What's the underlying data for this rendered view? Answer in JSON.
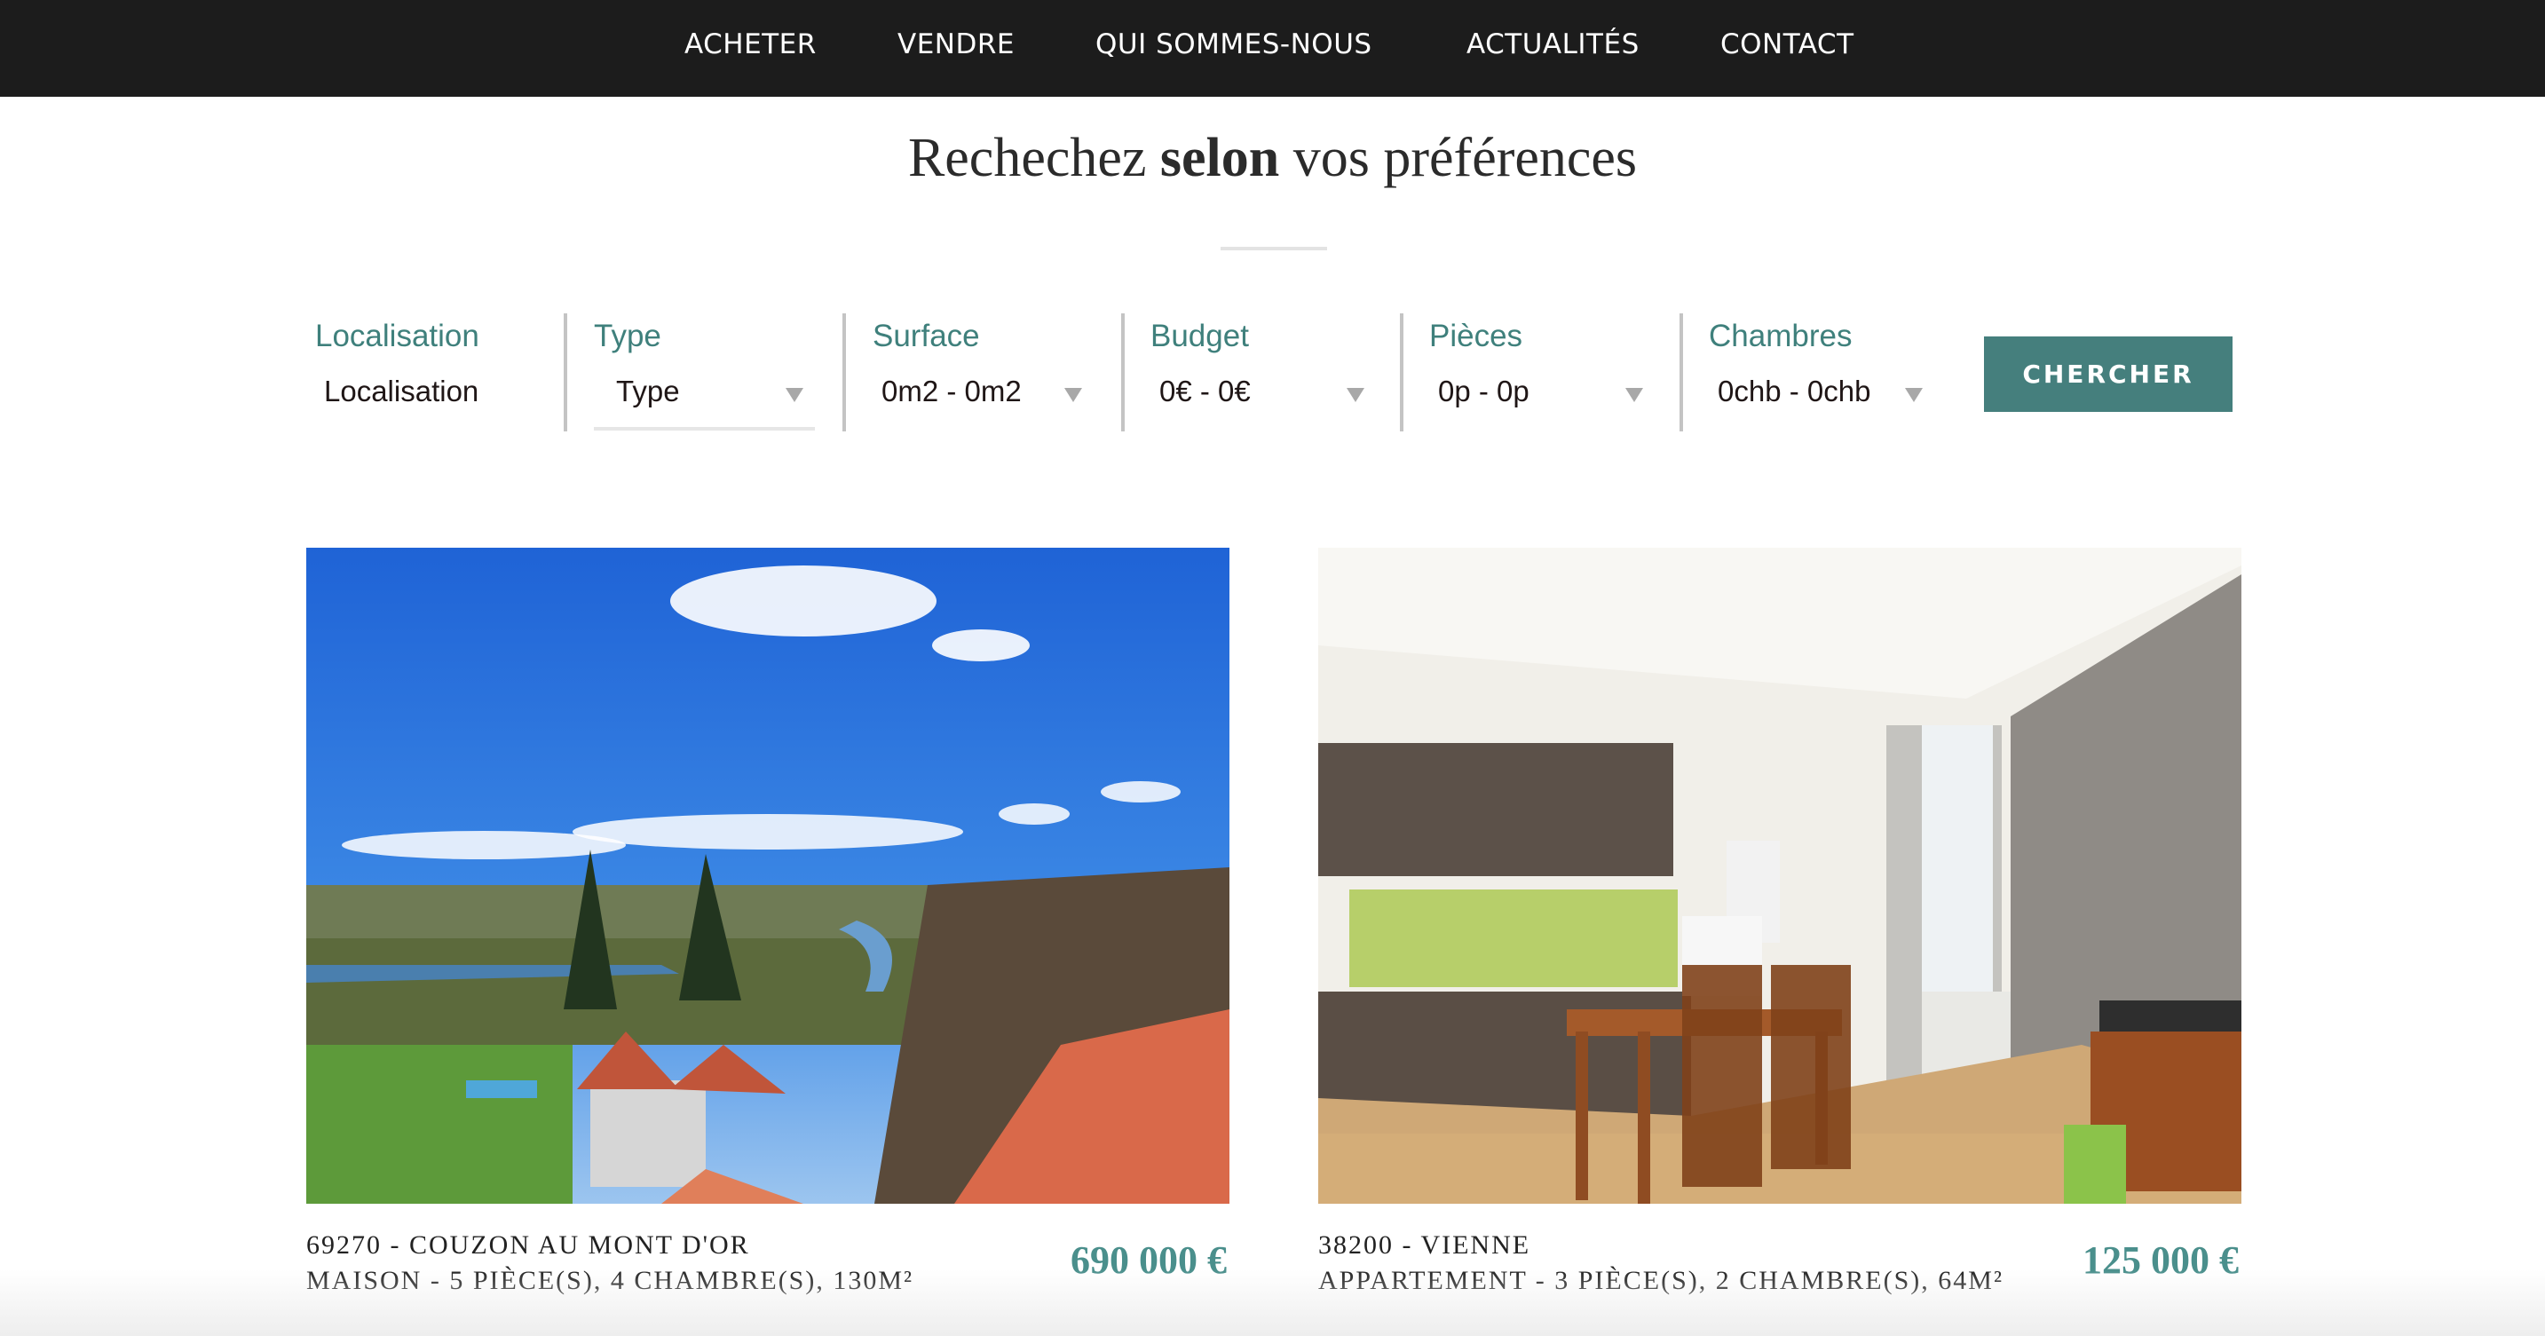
{
  "nav": {
    "items": [
      {
        "label": "ACHETER"
      },
      {
        "label": "VENDRE"
      },
      {
        "label": "QUI SOMMES-NOUS"
      },
      {
        "label": "ACTUALITÉS"
      },
      {
        "label": "CONTACT"
      }
    ]
  },
  "search": {
    "title_part1": "Rechechez ",
    "title_bold": "selon",
    "title_part2": " vos préférences",
    "fields": [
      {
        "label": "Localisation",
        "value": "Localisation",
        "type": "text"
      },
      {
        "label": "Type",
        "value": "Type",
        "type": "select"
      },
      {
        "label": "Surface",
        "value": "0m2 - 0m2",
        "type": "select"
      },
      {
        "label": "Budget",
        "value": "0€ - 0€",
        "type": "select"
      },
      {
        "label": "Pièces",
        "value": "0p - 0p",
        "type": "select"
      },
      {
        "label": "Chambres",
        "value": "0chb - 0chb",
        "type": "select"
      }
    ],
    "button_label": "CHERCHER"
  },
  "listings": [
    {
      "location": "69270 - COUZON AU MONT D'OR",
      "details": "MAISON - 5 PIÈCE(S), 4 CHAMBRE(S), 130M²",
      "price": "690 000 €",
      "image": "landscape-view-photo"
    },
    {
      "location": "38200 - VIENNE",
      "details": "APPARTEMENT - 3 PIÈCE(S), 2 CHAMBRE(S), 64M²",
      "price": "125 000 €",
      "image": "kitchen-dining-room-photo"
    }
  ],
  "colors": {
    "nav_bg": "#1c1c1c",
    "accent": "#457f7d",
    "label": "#3f807c",
    "price": "#4a8f8c"
  }
}
